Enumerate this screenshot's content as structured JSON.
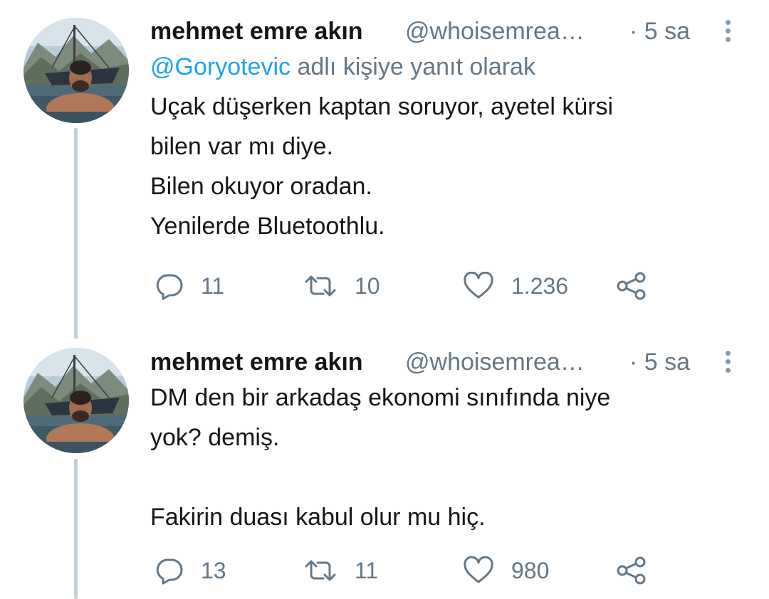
{
  "tweets": [
    {
      "author_name": "mehmet emre akın",
      "handle": "@whoisemrea…",
      "time": "· 5 sa",
      "reply_to_mention": "@Goryotevic",
      "reply_to_suffix": " adlı kişiye yanıt olarak",
      "text": "Uçak düşerken kaptan soruyor, ayetel kürsi\nbilen var mı diye.\nBilen okuyor oradan.\nYenilerde Bluetoothlu.",
      "replies": "11",
      "retweets": "10",
      "likes": "1.236"
    },
    {
      "author_name": "mehmet emre akın",
      "handle": "@whoisemrea…",
      "time": "· 5 sa",
      "text": "DM den bir arkadaş ekonomi sınıfında niye\nyok? demiş.\n\nFakirin duası kabul olur mu hiç.",
      "replies": "13",
      "retweets": "11",
      "likes": "980"
    }
  ],
  "icons": {
    "reply": "reply-icon",
    "retweet": "retweet-icon",
    "like": "heart-icon",
    "share": "share-icon",
    "more": "more-vertical-icon"
  },
  "colors": {
    "mention": "#1da1f2",
    "secondary_text": "#657786",
    "thread_line": "#c4cfd6"
  }
}
